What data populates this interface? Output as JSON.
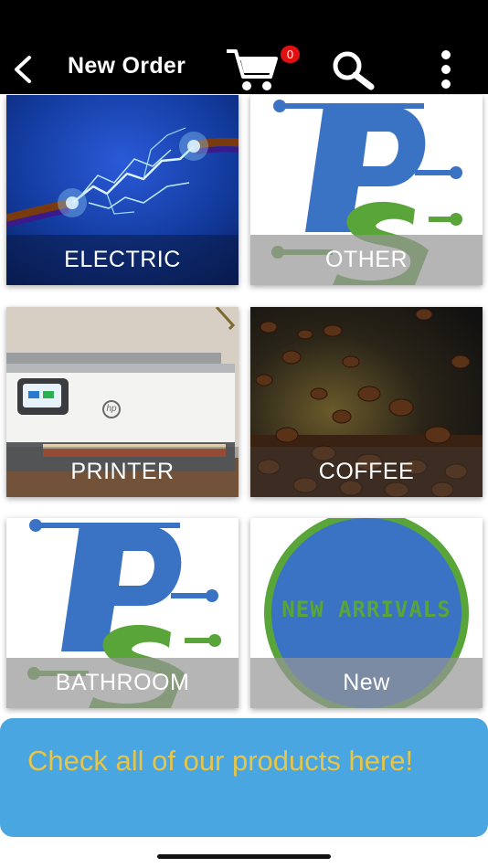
{
  "header": {
    "title": "New Order",
    "cart_count": "0"
  },
  "categories": [
    {
      "label": "ELECTRIC"
    },
    {
      "label": "OTHER"
    },
    {
      "label": "PRINTER"
    },
    {
      "label": "COFFEE"
    },
    {
      "label": "BATHROOM"
    },
    {
      "label": "New"
    }
  ],
  "new_arrivals_badge": "NEW ARRIVALS",
  "printer_brand": "hp",
  "banner": {
    "text": "Check all of our products here!"
  },
  "colors": {
    "header_bg": "#000000",
    "badge_red": "#e01010",
    "banner_bg": "#4aa6e0",
    "banner_text": "#e6c548",
    "logo_blue": "#3a72c4",
    "logo_green": "#5aa53a"
  },
  "icons": [
    "back-arrow-icon",
    "cart-icon",
    "search-icon",
    "more-vertical-icon"
  ]
}
